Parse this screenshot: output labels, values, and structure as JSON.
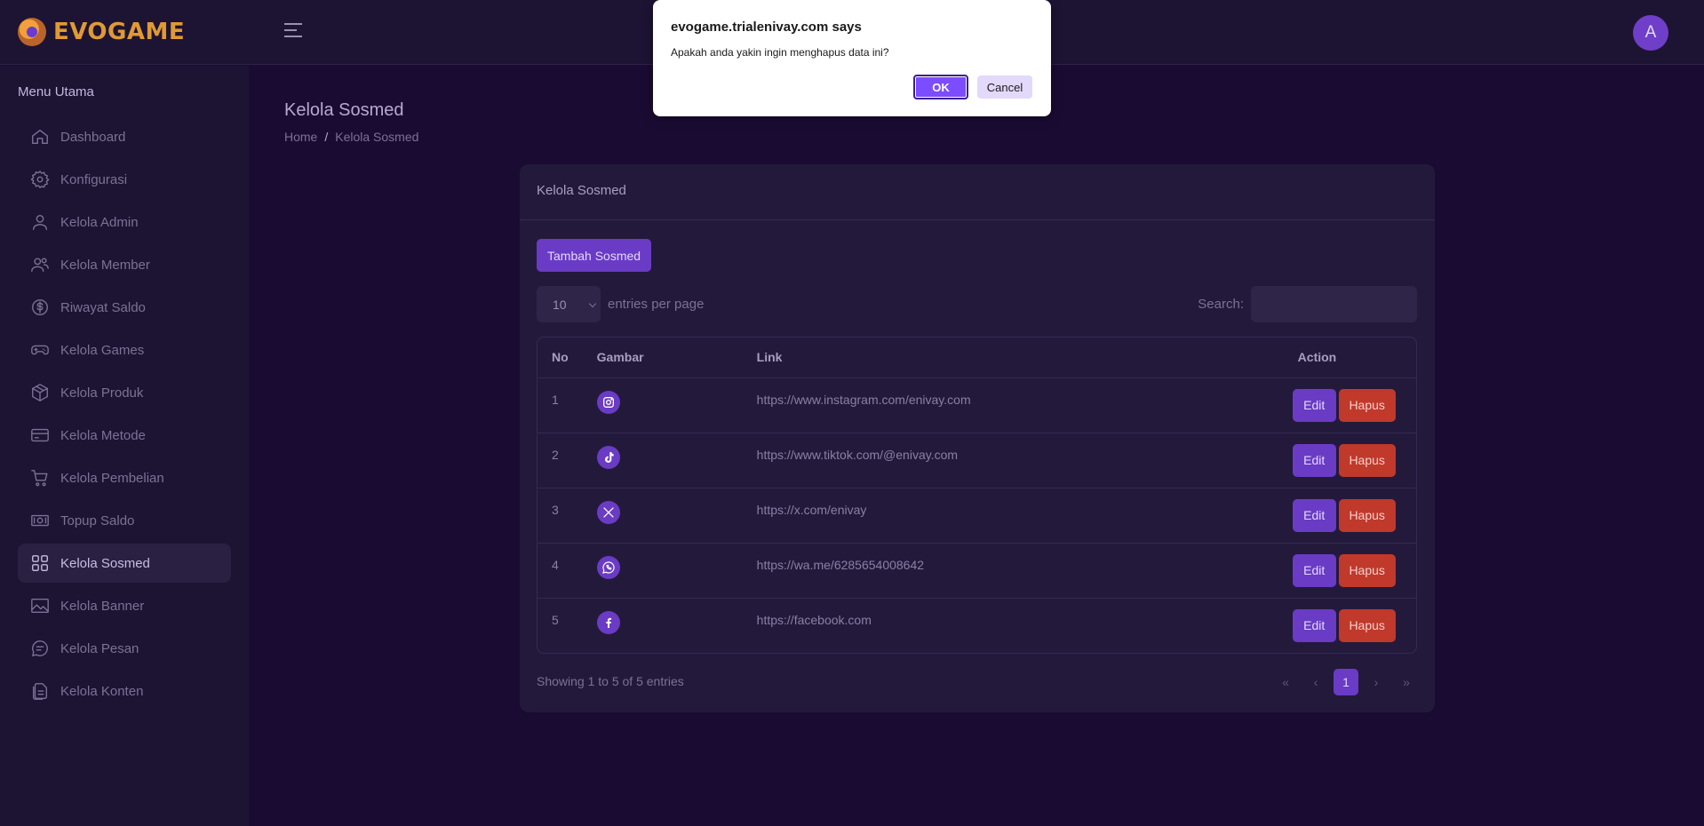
{
  "header": {
    "logo_text": "EVOGAME",
    "avatar_letter": "A"
  },
  "sidebar": {
    "title": "Menu Utama",
    "items": [
      {
        "label": "Dashboard",
        "icon": "home-icon"
      },
      {
        "label": "Konfigurasi",
        "icon": "gear-icon"
      },
      {
        "label": "Kelola Admin",
        "icon": "user-icon"
      },
      {
        "label": "Kelola Member",
        "icon": "users-icon"
      },
      {
        "label": "Riwayat Saldo",
        "icon": "dollar-icon"
      },
      {
        "label": "Kelola Games",
        "icon": "gamepad-icon"
      },
      {
        "label": "Kelola Produk",
        "icon": "box-icon"
      },
      {
        "label": "Kelola Metode",
        "icon": "card-icon"
      },
      {
        "label": "Kelola Pembelian",
        "icon": "cart-icon"
      },
      {
        "label": "Topup Saldo",
        "icon": "money-icon"
      },
      {
        "label": "Kelola Sosmed",
        "icon": "grid-icon",
        "active": true
      },
      {
        "label": "Kelola Banner",
        "icon": "image-icon"
      },
      {
        "label": "Kelola Pesan",
        "icon": "chat-icon"
      },
      {
        "label": "Kelola Konten",
        "icon": "files-icon"
      }
    ]
  },
  "page": {
    "title": "Kelola Sosmed",
    "breadcrumb": {
      "home": "Home",
      "sep": "/",
      "current": "Kelola Sosmed"
    }
  },
  "card": {
    "title": "Kelola Sosmed",
    "add_button": "Tambah Sosmed",
    "length_value": "10",
    "length_label": "entries per page",
    "search_label": "Search:",
    "search_value": "",
    "columns": [
      "No",
      "Gambar",
      "Link",
      "Action"
    ],
    "rows": [
      {
        "no": "1",
        "icon": "instagram-icon",
        "link": "https://www.instagram.com/enivay.com",
        "edit": "Edit",
        "delete": "Hapus"
      },
      {
        "no": "2",
        "icon": "tiktok-icon",
        "link": "https://www.tiktok.com/@enivay.com",
        "edit": "Edit",
        "delete": "Hapus"
      },
      {
        "no": "3",
        "icon": "x-icon",
        "link": "https://x.com/enivay",
        "edit": "Edit",
        "delete": "Hapus"
      },
      {
        "no": "4",
        "icon": "whatsapp-icon",
        "link": "https://wa.me/6285654008642",
        "edit": "Edit",
        "delete": "Hapus"
      },
      {
        "no": "5",
        "icon": "facebook-icon",
        "link": "https://facebook.com",
        "edit": "Edit",
        "delete": "Hapus"
      }
    ],
    "info": "Showing 1 to 5 of 5 entries",
    "pager": {
      "first": "«",
      "prev": "‹",
      "current": "1",
      "next": "›",
      "last": "»"
    }
  },
  "dialog": {
    "title": "evogame.trialenivay.com says",
    "message": "Apakah anda yakin ingin menghapus data ini?",
    "ok": "OK",
    "cancel": "Cancel"
  }
}
